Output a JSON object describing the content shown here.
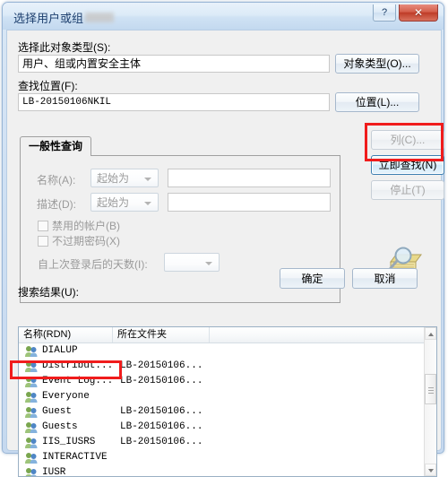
{
  "window": {
    "title": "选择用户或组",
    "help_label": "?",
    "close_label": "✕"
  },
  "object_type": {
    "label": "选择此对象类型(S):",
    "value": "用户、组或内置安全主体",
    "button": "对象类型(O)..."
  },
  "location": {
    "label": "查找位置(F):",
    "value": "LB-20150106NKIL",
    "button": "位置(L)..."
  },
  "query_tab": {
    "tab_label": "一般性查询",
    "name_label": "名称(A):",
    "name_condition": "起始为",
    "name_value": "",
    "desc_label": "描述(D):",
    "desc_condition": "起始为",
    "desc_value": "",
    "disabled_accounts": "禁用的帐户(B)",
    "non_expiring_password": "不过期密码(X)",
    "days_since_logon_label": "自上次登录后的天数(I):",
    "days_since_logon_value": ""
  },
  "side_buttons": {
    "columns": "列(C)...",
    "find_now": "立即查找(N)",
    "stop": "停止(T)"
  },
  "dialog_buttons": {
    "ok": "确定",
    "cancel": "取消"
  },
  "results": {
    "label": "搜索结果(U):",
    "columns": [
      "名称(RDN)",
      "所在文件夹",
      ""
    ],
    "rows": [
      {
        "name": "DIALUP",
        "folder": ""
      },
      {
        "name": "Distribut...",
        "folder": "LB-20150106..."
      },
      {
        "name": "Event Log...",
        "folder": "LB-20150106..."
      },
      {
        "name": "Everyone",
        "folder": ""
      },
      {
        "name": "Guest",
        "folder": "LB-20150106..."
      },
      {
        "name": "Guests",
        "folder": "LB-20150106..."
      },
      {
        "name": "IIS_IUSRS",
        "folder": "LB-20150106..."
      },
      {
        "name": "INTERACTIVE",
        "folder": ""
      },
      {
        "name": "IUSR",
        "folder": ""
      }
    ]
  },
  "annotations": {
    "highlight_color": "#f01c1c",
    "boxes": [
      "find-now-button",
      "everyone-row"
    ]
  }
}
